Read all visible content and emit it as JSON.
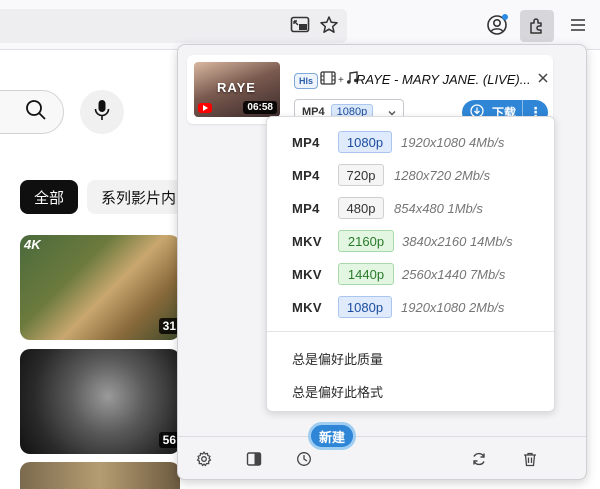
{
  "browser": {
    "toolbar_icons": [
      "picture-in-picture-icon",
      "bookmark-star-icon",
      "account-icon",
      "extensions-icon",
      "hamburger-menu-icon"
    ]
  },
  "youtube": {
    "chips": [
      "全部",
      "系列影片内"
    ],
    "thumbnails": [
      {
        "badge": "4K",
        "duration": "31"
      },
      {
        "badge": "",
        "duration": "56"
      }
    ]
  },
  "popup": {
    "card": {
      "thumb_text": "RAYE",
      "duration": "06:58",
      "tag": "Hls",
      "title": "RAYE - MARY JANE. (LIVE)...",
      "selected_format": "MP4",
      "selected_resolution": "1080p",
      "download_label": "下载"
    },
    "formats": [
      {
        "format": "MP4",
        "resolution": "1080p",
        "details": "1920x1080 4Mb/s",
        "color": "blue"
      },
      {
        "format": "MP4",
        "resolution": "720p",
        "details": "1280x720 2Mb/s",
        "color": "grey"
      },
      {
        "format": "MP4",
        "resolution": "480p",
        "details": "854x480 1Mb/s",
        "color": "grey"
      },
      {
        "format": "MKV",
        "resolution": "2160p",
        "details": "3840x2160 14Mb/s",
        "color": "green"
      },
      {
        "format": "MKV",
        "resolution": "1440p",
        "details": "2560x1440 7Mb/s",
        "color": "green"
      },
      {
        "format": "MKV",
        "resolution": "1080p",
        "details": "1920x1080 2Mb/s",
        "color": "blue"
      }
    ],
    "preferences": [
      "总是偏好此质量",
      "总是偏好此格式"
    ],
    "new_button": "新建",
    "bottom_icons": [
      "settings-icon",
      "sidebar-icon",
      "history-icon",
      "refresh-icon",
      "trash-icon"
    ],
    "accent": "#2f86d6"
  }
}
